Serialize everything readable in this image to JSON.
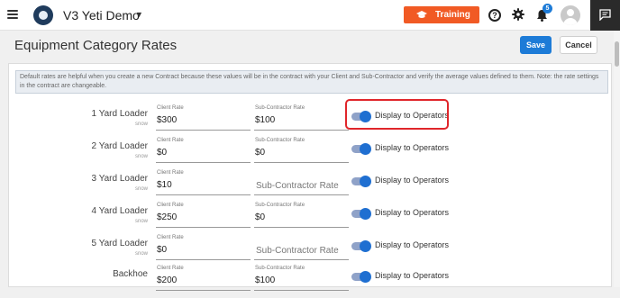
{
  "app": {
    "title": "V3 Yeti Demo"
  },
  "header": {
    "training_label": "Training",
    "notification_count": "5"
  },
  "page": {
    "title": "Equipment Category Rates",
    "save_label": "Save",
    "cancel_label": "Cancel",
    "info_text": "Default rates are helpful when you create a new Contract because these values will be in the contract with your Client and Sub-Contractor and verify the average values defined to them. Note: the rate settings in the contract are changeable."
  },
  "rates": [
    {
      "name": "1 Yard Loader",
      "sub": "snow",
      "client_label": "Client Rate",
      "client_value": "$300",
      "sub_label": "Sub-Contractor Rate",
      "sub_value": "$100",
      "sub_placeholder": "",
      "toggle_label": "Display to Operators",
      "toggle_on": true
    },
    {
      "name": "2 Yard Loader",
      "sub": "snow",
      "client_label": "Client Rate",
      "client_value": "$0",
      "sub_label": "Sub-Contractor Rate",
      "sub_value": "$0",
      "sub_placeholder": "",
      "toggle_label": "Display to Operators",
      "toggle_on": true
    },
    {
      "name": "3 Yard Loader",
      "sub": "snow",
      "client_label": "Client Rate",
      "client_value": "$10",
      "sub_label": "",
      "sub_value": "",
      "sub_placeholder": "Sub-Contractor Rate",
      "toggle_label": "Display to Operators",
      "toggle_on": true
    },
    {
      "name": "4 Yard Loader",
      "sub": "snow",
      "client_label": "Client Rate",
      "client_value": "$250",
      "sub_label": "Sub-Contractor Rate",
      "sub_value": "$0",
      "sub_placeholder": "",
      "toggle_label": "Display to Operators",
      "toggle_on": true
    },
    {
      "name": "5 Yard Loader",
      "sub": "snow",
      "client_label": "Client Rate",
      "client_value": "$0",
      "sub_label": "",
      "sub_value": "",
      "sub_placeholder": "Sub-Contractor Rate",
      "toggle_label": "Display to Operators",
      "toggle_on": true
    },
    {
      "name": "Backhoe",
      "sub": "",
      "client_label": "Client Rate",
      "client_value": "$200",
      "sub_label": "Sub-Contractor Rate",
      "sub_value": "$100",
      "sub_placeholder": "",
      "toggle_label": "Display to Operators",
      "toggle_on": true
    }
  ],
  "colors": {
    "accent": "#1d7bd7",
    "training": "#f15a24",
    "highlight": "#e0262b"
  },
  "icons": [
    "hamburger-icon",
    "app-logo-icon",
    "chevron-down-icon",
    "graduation-cap-icon",
    "help-icon",
    "gear-icon",
    "bell-icon",
    "avatar-icon",
    "chat-icon"
  ]
}
